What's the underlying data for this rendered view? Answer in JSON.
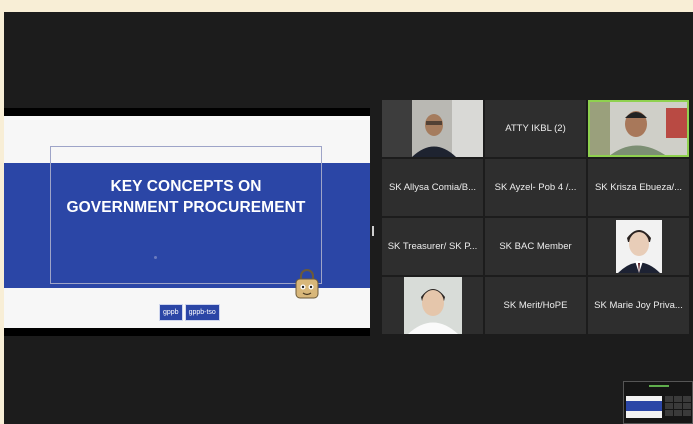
{
  "slide": {
    "title_line1": "KEY CONCEPTS ON",
    "title_line2": "GOVERNMENT PROCUREMENT",
    "logos": [
      "gppb",
      "gppb-tso"
    ]
  },
  "participants": [
    {
      "label": "",
      "kind": "video-man-glasses"
    },
    {
      "label": "ATTY IKBL (2)",
      "kind": "name"
    },
    {
      "label": "",
      "kind": "video-man-active",
      "speaking": true
    },
    {
      "label": "SK Allysa Comia/B...",
      "kind": "name"
    },
    {
      "label": "SK Ayzel- Pob 4 /...",
      "kind": "name"
    },
    {
      "label": "SK Krisza Ebueza/...",
      "kind": "name"
    },
    {
      "label": "SK Treasurer/ SK P...",
      "kind": "name"
    },
    {
      "label": "SK BAC Member",
      "kind": "name"
    },
    {
      "label": "",
      "kind": "photo-suit"
    },
    {
      "label": "",
      "kind": "photo-white-shirt"
    },
    {
      "label": "SK Merit/HoPE",
      "kind": "name"
    },
    {
      "label": "SK Marie Joy Priva...",
      "kind": "name"
    }
  ],
  "colors": {
    "slide_band": "#2b46a6",
    "tile_bg": "#2e2e2e",
    "speaking_border": "#8fd14f"
  }
}
